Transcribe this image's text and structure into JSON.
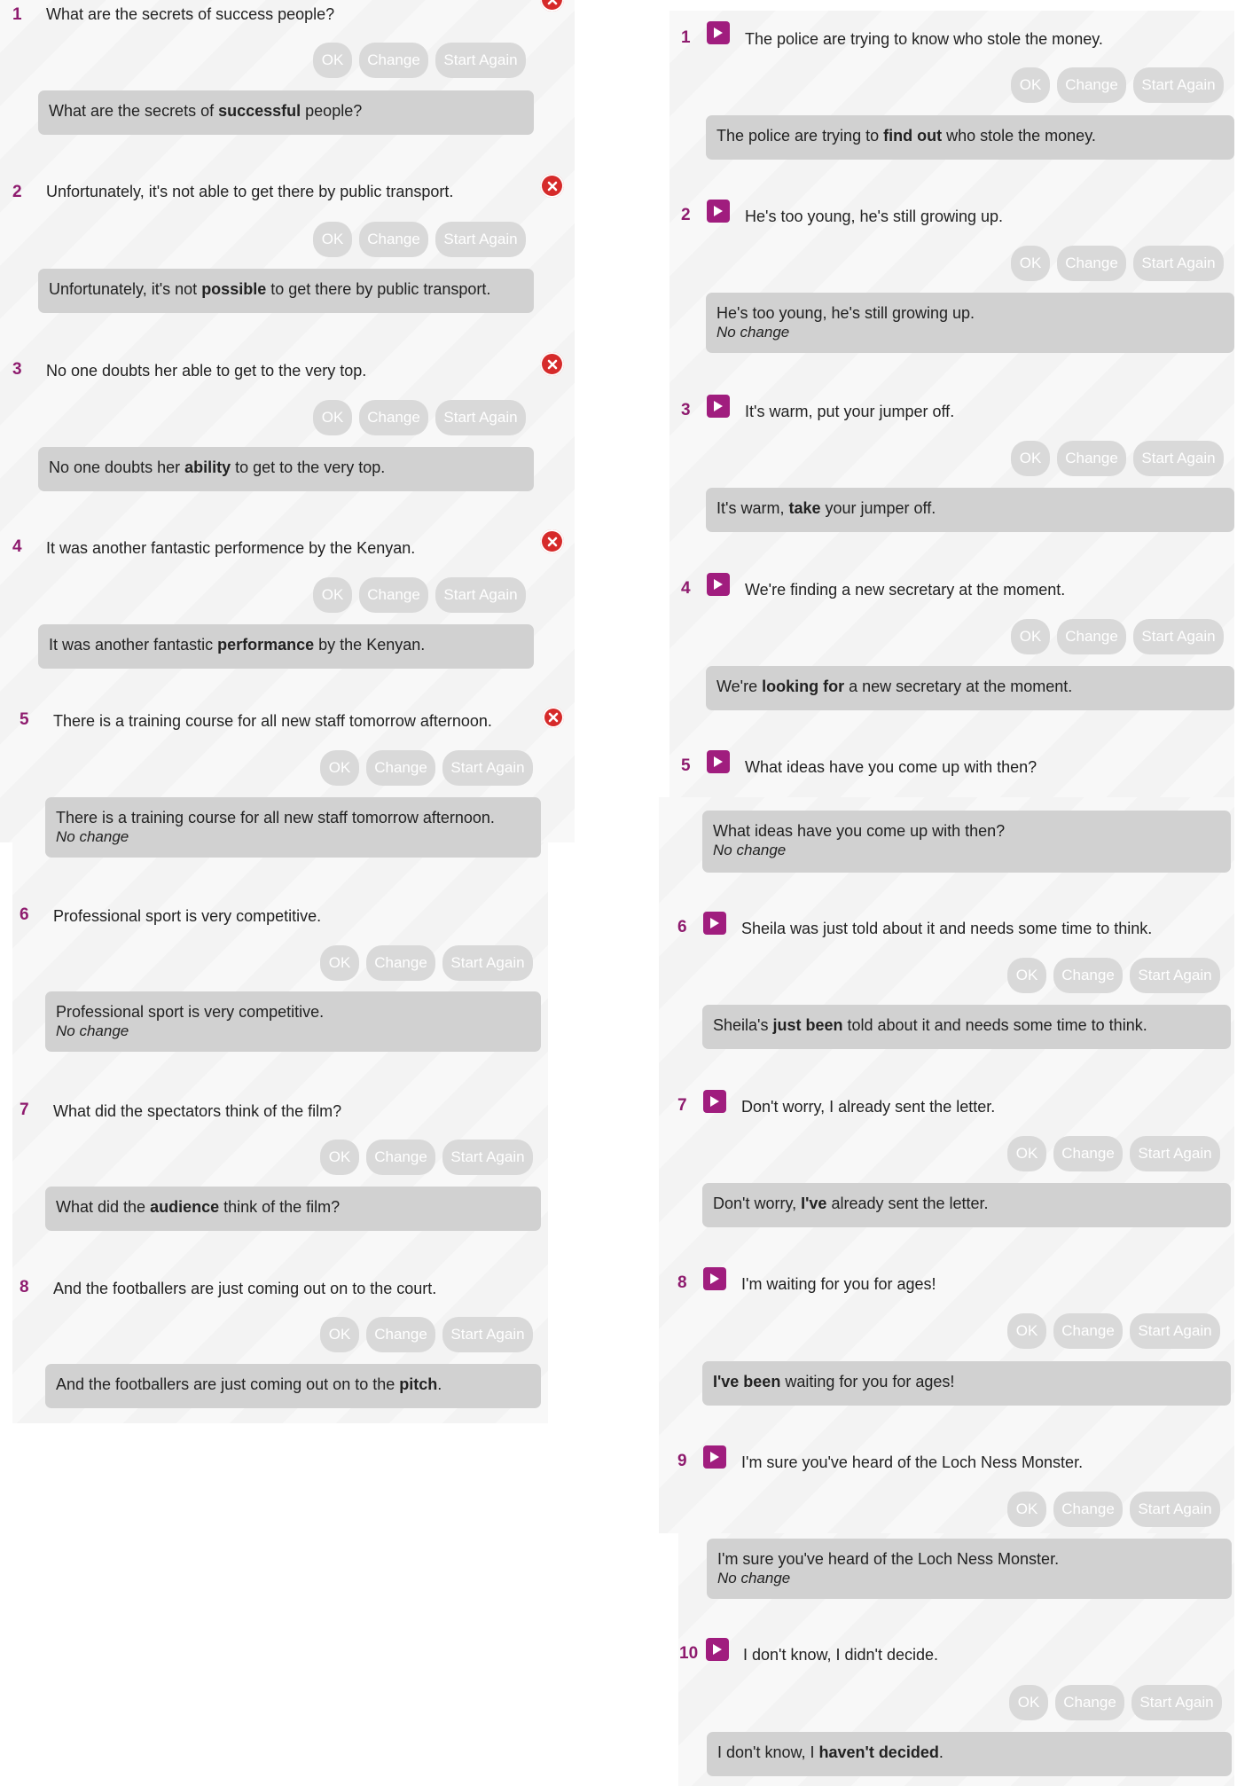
{
  "buttons": {
    "ok": "OK",
    "change": "Change",
    "start_again": "Start Again"
  },
  "left": [
    {
      "num": "1",
      "question": "What are the secrets of success people?",
      "answer_pre": "What are the secrets of ",
      "answer_bold": "successful",
      "answer_post": " people?",
      "no_change": ""
    },
    {
      "num": "2",
      "question": "Unfortunately, it's not able to get there by public transport.",
      "answer_pre": "Unfortunately, it's not ",
      "answer_bold": "possible",
      "answer_post": " to get there by public transport.",
      "no_change": ""
    },
    {
      "num": "3",
      "question": "No one doubts her able to get to the very top.",
      "answer_pre": "No one doubts her ",
      "answer_bold": "ability",
      "answer_post": " to get to the very top.",
      "no_change": ""
    },
    {
      "num": "4",
      "question": "It was another fantastic performence by the Kenyan.",
      "answer_pre": "It was another fantastic ",
      "answer_bold": "performance",
      "answer_post": " by the Kenyan.",
      "no_change": ""
    },
    {
      "num": "5",
      "question": "There is a training course for all new staff tomorrow afternoon.",
      "answer_pre": "There is a training course for all new staff tomorrow afternoon.",
      "answer_bold": "",
      "answer_post": "",
      "no_change": "No change"
    },
    {
      "num": "6",
      "question": "Professional sport is very competitive.",
      "answer_pre": "Professional sport is very competitive.",
      "answer_bold": "",
      "answer_post": "",
      "no_change": "No change"
    },
    {
      "num": "7",
      "question": "What did the spectators think of the film?",
      "answer_pre": "What did the ",
      "answer_bold": "audience",
      "answer_post": " think of the film?",
      "no_change": ""
    },
    {
      "num": "8",
      "question": "And the footballers are just coming out on to the court.",
      "answer_pre": "And the footballers are just coming out on to the ",
      "answer_bold": "pitch",
      "answer_post": ".",
      "no_change": ""
    }
  ],
  "right": [
    {
      "num": "1",
      "question": "The police are trying to know who stole the money.",
      "answer_pre": "The police are trying to ",
      "answer_bold": "find out",
      "answer_post": " who stole the money.",
      "no_change": ""
    },
    {
      "num": "2",
      "question": "He's too young, he's still growing up.",
      "answer_pre": "He's too young, he's still growing up.",
      "answer_bold": "",
      "answer_post": "",
      "no_change": "No change"
    },
    {
      "num": "3",
      "question": "It's warm, put your jumper off.",
      "answer_pre": "It's warm, ",
      "answer_bold": "take",
      "answer_post": " your jumper off.",
      "no_change": ""
    },
    {
      "num": "4",
      "question": "We're finding a new secretary at the moment.",
      "answer_pre": "We're ",
      "answer_bold": "looking for",
      "answer_post": " a new secretary at the moment.",
      "no_change": ""
    },
    {
      "num": "5",
      "question": "What ideas have you come up with then?",
      "answer_pre": "What ideas have you come up with then?",
      "answer_bold": "",
      "answer_post": "",
      "no_change": "No change"
    },
    {
      "num": "6",
      "question": "Sheila was just told about it and needs some time to think.",
      "answer_pre": "Sheila's ",
      "answer_bold": "just been",
      "answer_post": " told about it and needs some time to think.",
      "no_change": ""
    },
    {
      "num": "7",
      "question": "Don't worry, I already sent the letter.",
      "answer_pre": "Don't worry, ",
      "answer_bold": "I've",
      "answer_post": " already sent the letter.",
      "no_change": ""
    },
    {
      "num": "8",
      "question": "I'm waiting for you for ages!",
      "answer_pre": "",
      "answer_bold": "I've been",
      "answer_post": " waiting for you for ages!",
      "no_change": ""
    },
    {
      "num": "9",
      "question": "I'm sure you've heard of the Loch Ness Monster.",
      "answer_pre": "I'm sure you've heard of the Loch Ness Monster.",
      "answer_bold": "",
      "answer_post": "",
      "no_change": "No change"
    },
    {
      "num": "10",
      "question": "I don't know, I didn't decide.",
      "answer_pre": "I don't know, I ",
      "answer_bold": "haven't decided",
      "answer_post": ".",
      "no_change": ""
    }
  ]
}
